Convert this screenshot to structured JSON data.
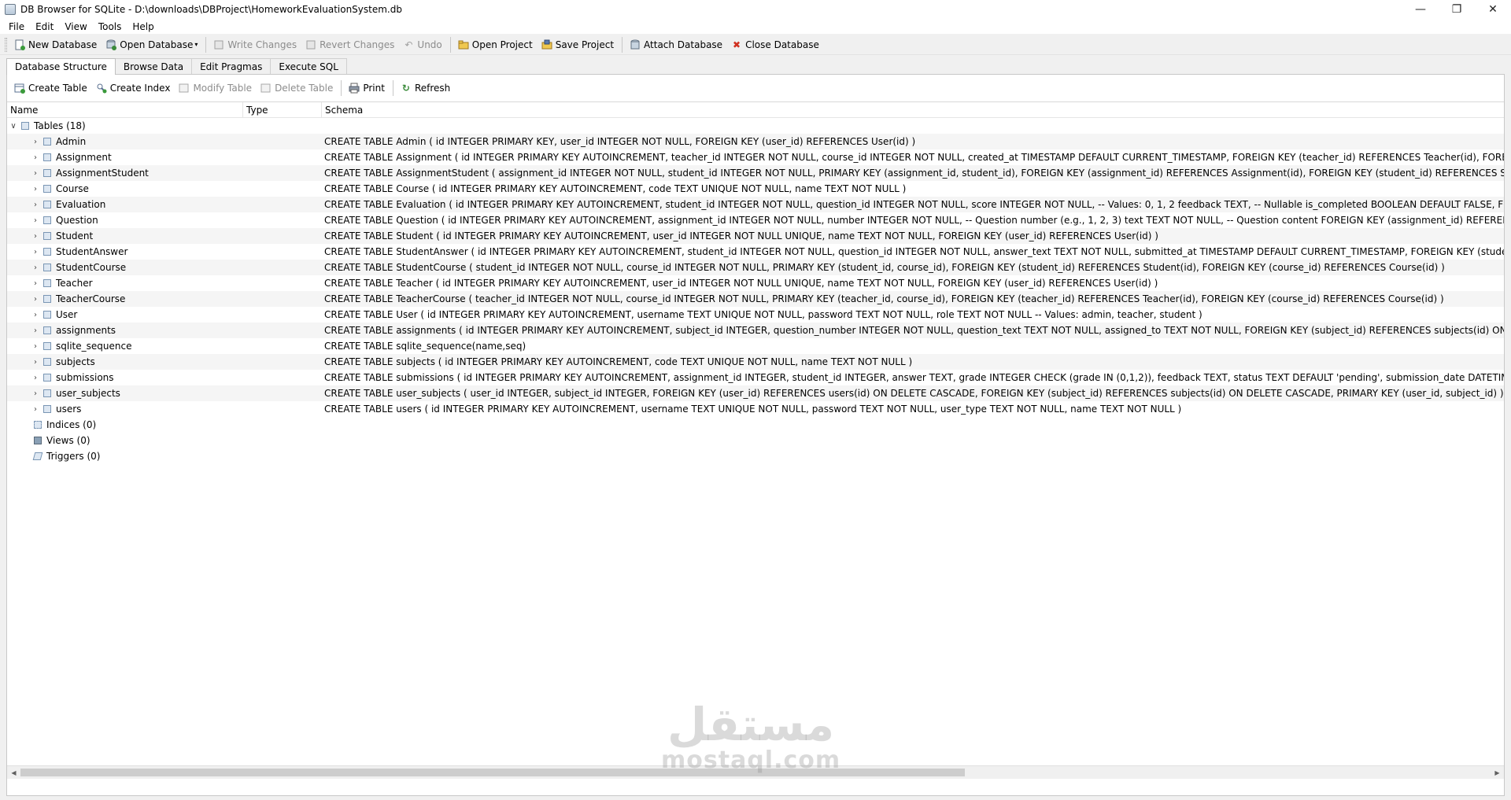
{
  "window": {
    "title": "DB Browser for SQLite - D:\\downloads\\DBProject\\HomeworkEvaluationSystem.db"
  },
  "menu": [
    "File",
    "Edit",
    "View",
    "Tools",
    "Help"
  ],
  "toolbar": {
    "new_database": "New Database",
    "open_database": "Open Database",
    "write_changes": "Write Changes",
    "revert_changes": "Revert Changes",
    "undo": "Undo",
    "open_project": "Open Project",
    "save_project": "Save Project",
    "attach_database": "Attach Database",
    "close_database": "Close Database"
  },
  "tabs": [
    "Database Structure",
    "Browse Data",
    "Edit Pragmas",
    "Execute SQL"
  ],
  "structure_toolbar": {
    "create_table": "Create Table",
    "create_index": "Create Index",
    "modify_table": "Modify Table",
    "delete_table": "Delete Table",
    "print": "Print",
    "refresh": "Refresh"
  },
  "tree": {
    "columns": [
      "Name",
      "Type",
      "Schema"
    ],
    "tables_label": "Tables (18)",
    "tables": [
      {
        "name": "Admin",
        "schema": "CREATE TABLE Admin ( id INTEGER PRIMARY KEY, user_id INTEGER NOT NULL, FOREIGN KEY (user_id) REFERENCES User(id) )"
      },
      {
        "name": "Assignment",
        "schema": "CREATE TABLE Assignment ( id INTEGER PRIMARY KEY AUTOINCREMENT, teacher_id INTEGER NOT NULL, course_id INTEGER NOT NULL, created_at TIMESTAMP DEFAULT CURRENT_TIMESTAMP, FOREIGN KEY (teacher_id) REFERENCES Teacher(id), FOREIGN KE"
      },
      {
        "name": "AssignmentStudent",
        "schema": "CREATE TABLE AssignmentStudent ( assignment_id INTEGER NOT NULL, student_id INTEGER NOT NULL, PRIMARY KEY (assignment_id, student_id), FOREIGN KEY (assignment_id) REFERENCES Assignment(id), FOREIGN KEY (student_id) REFERENCES Student(id)"
      },
      {
        "name": "Course",
        "schema": "CREATE TABLE Course ( id INTEGER PRIMARY KEY AUTOINCREMENT, code TEXT UNIQUE NOT NULL, name TEXT NOT NULL )"
      },
      {
        "name": "Evaluation",
        "schema": "CREATE TABLE Evaluation ( id INTEGER PRIMARY KEY AUTOINCREMENT, student_id INTEGER NOT NULL, question_id INTEGER NOT NULL, score INTEGER NOT NULL, -- Values: 0, 1, 2 feedback TEXT, -- Nullable is_completed BOOLEAN DEFAULT FALSE, FOREIGN K"
      },
      {
        "name": "Question",
        "schema": "CREATE TABLE Question ( id INTEGER PRIMARY KEY AUTOINCREMENT, assignment_id INTEGER NOT NULL, number INTEGER NOT NULL, -- Question number (e.g., 1, 2, 3) text TEXT NOT NULL, -- Question content FOREIGN KEY (assignment_id) REFERENCES Assi"
      },
      {
        "name": "Student",
        "schema": "CREATE TABLE Student ( id INTEGER PRIMARY KEY AUTOINCREMENT, user_id INTEGER NOT NULL UNIQUE, name TEXT NOT NULL, FOREIGN KEY (user_id) REFERENCES User(id) )"
      },
      {
        "name": "StudentAnswer",
        "schema": "CREATE TABLE StudentAnswer ( id INTEGER PRIMARY KEY AUTOINCREMENT, student_id INTEGER NOT NULL, question_id INTEGER NOT NULL, answer_text TEXT NOT NULL, submitted_at TIMESTAMP DEFAULT CURRENT_TIMESTAMP, FOREIGN KEY (student_id) R"
      },
      {
        "name": "StudentCourse",
        "schema": "CREATE TABLE StudentCourse ( student_id INTEGER NOT NULL, course_id INTEGER NOT NULL, PRIMARY KEY (student_id, course_id), FOREIGN KEY (student_id) REFERENCES Student(id), FOREIGN KEY (course_id) REFERENCES Course(id) )"
      },
      {
        "name": "Teacher",
        "schema": "CREATE TABLE Teacher ( id INTEGER PRIMARY KEY AUTOINCREMENT, user_id INTEGER NOT NULL UNIQUE, name TEXT NOT NULL, FOREIGN KEY (user_id) REFERENCES User(id) )"
      },
      {
        "name": "TeacherCourse",
        "schema": "CREATE TABLE TeacherCourse ( teacher_id INTEGER NOT NULL, course_id INTEGER NOT NULL, PRIMARY KEY (teacher_id, course_id), FOREIGN KEY (teacher_id) REFERENCES Teacher(id), FOREIGN KEY (course_id) REFERENCES Course(id) )"
      },
      {
        "name": "User",
        "schema": "CREATE TABLE User ( id INTEGER PRIMARY KEY AUTOINCREMENT, username TEXT UNIQUE NOT NULL, password TEXT NOT NULL, role TEXT NOT NULL -- Values: admin, teacher, student )"
      },
      {
        "name": "assignments",
        "schema": "CREATE TABLE assignments ( id INTEGER PRIMARY KEY AUTOINCREMENT, subject_id INTEGER, question_number INTEGER NOT NULL, question_text TEXT NOT NULL, assigned_to TEXT NOT NULL, FOREIGN KEY (subject_id) REFERENCES subjects(id) ON DELETE"
      },
      {
        "name": "sqlite_sequence",
        "schema": "CREATE TABLE sqlite_sequence(name,seq)"
      },
      {
        "name": "subjects",
        "schema": "CREATE TABLE subjects ( id INTEGER PRIMARY KEY AUTOINCREMENT, code TEXT UNIQUE NOT NULL, name TEXT NOT NULL )"
      },
      {
        "name": "submissions",
        "schema": "CREATE TABLE submissions ( id INTEGER PRIMARY KEY AUTOINCREMENT, assignment_id INTEGER, student_id INTEGER, answer TEXT, grade INTEGER CHECK (grade IN (0,1,2)), feedback TEXT, status TEXT DEFAULT 'pending', submission_date DATETIME DEFA"
      },
      {
        "name": "user_subjects",
        "schema": "CREATE TABLE user_subjects ( user_id INTEGER, subject_id INTEGER, FOREIGN KEY (user_id) REFERENCES users(id) ON DELETE CASCADE, FOREIGN KEY (subject_id) REFERENCES subjects(id) ON DELETE CASCADE, PRIMARY KEY (user_id, subject_id) )"
      },
      {
        "name": "users",
        "schema": "CREATE TABLE users ( id INTEGER PRIMARY KEY AUTOINCREMENT, username TEXT UNIQUE NOT NULL, password TEXT NOT NULL, user_type TEXT NOT NULL, name TEXT NOT NULL )"
      }
    ],
    "indices_label": "Indices (0)",
    "views_label": "Views (0)",
    "triggers_label": "Triggers (0)"
  },
  "watermark": {
    "arabic": "مستقل",
    "latin": "mostaql.com"
  }
}
